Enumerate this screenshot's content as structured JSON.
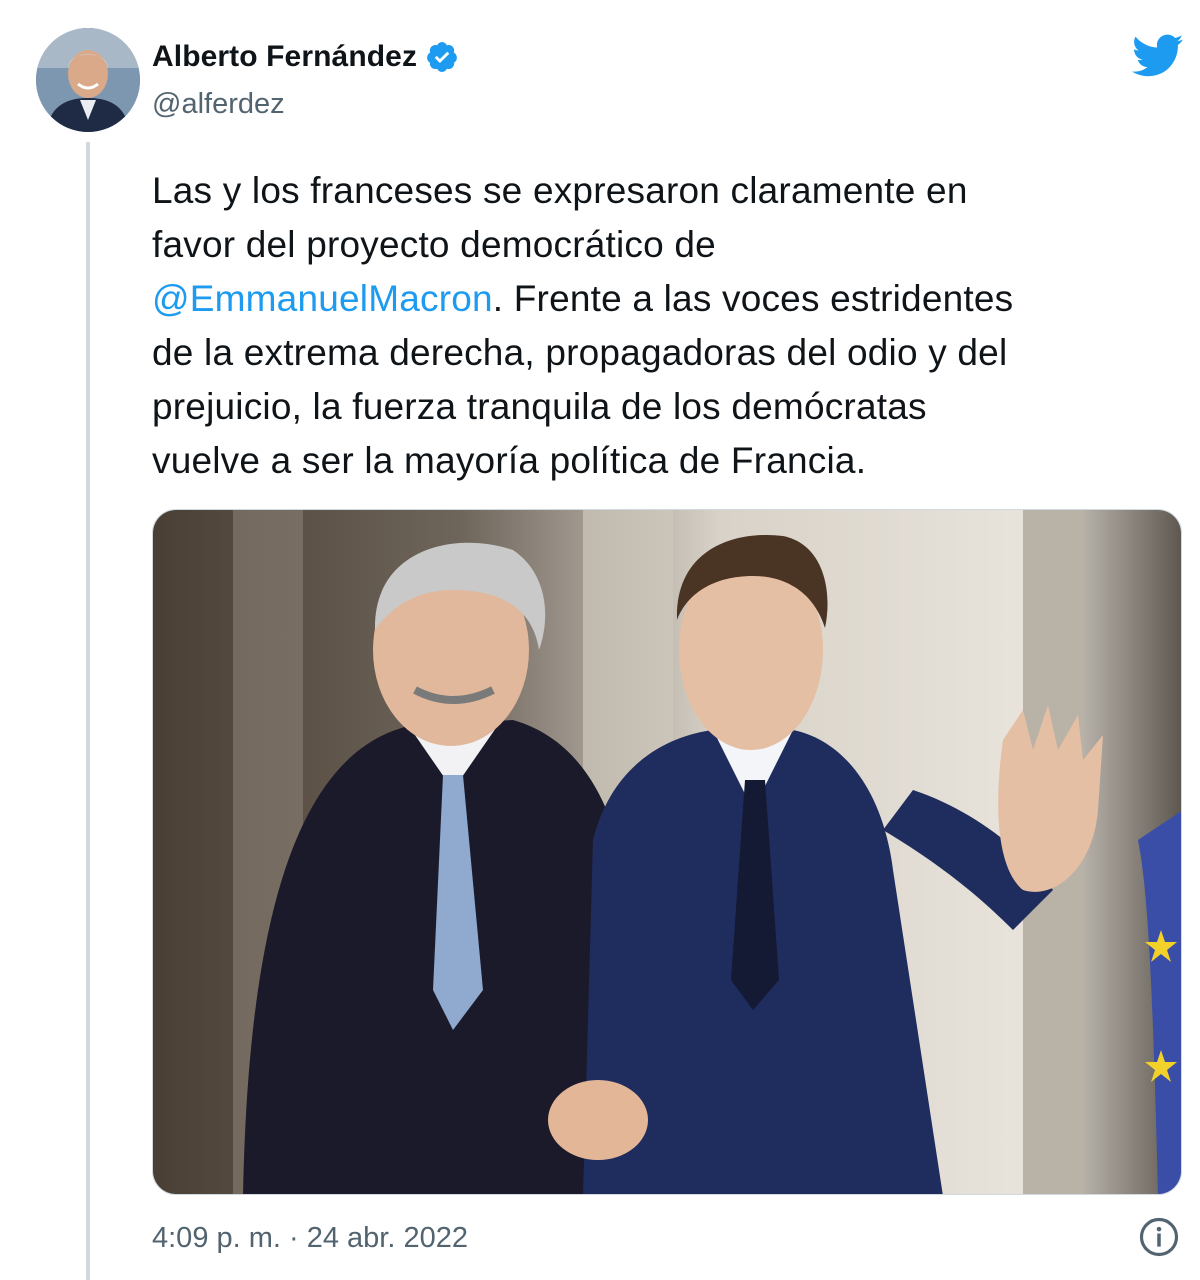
{
  "author": {
    "display_name": "Alberto Fernández",
    "handle": "@alferdez",
    "verified_icon": "verified-badge-icon",
    "avatar": "author-avatar"
  },
  "tweet": {
    "text_line1": "Las y los franceses se expresaron claramente en",
    "text_line2": "favor del proyecto democrático de",
    "mention": "@EmmanuelMacron",
    "text_line3_rest": ". Frente a las voces estridentes",
    "text_line4": "de la extrema derecha, propagadoras del odio y del",
    "text_line5": "prejuicio, la fuerza tranquila de los demócratas",
    "text_line6": "vuelve a ser la mayoría política de Francia.",
    "timestamp": "4:09 p. m. · 24 abr. 2022"
  },
  "icons": {
    "brand": "twitter-bird-icon",
    "info": "info-icon"
  },
  "colors": {
    "link": "#1d9bf0",
    "brand": "#1d9bf0",
    "secondary_text": "#536471"
  }
}
